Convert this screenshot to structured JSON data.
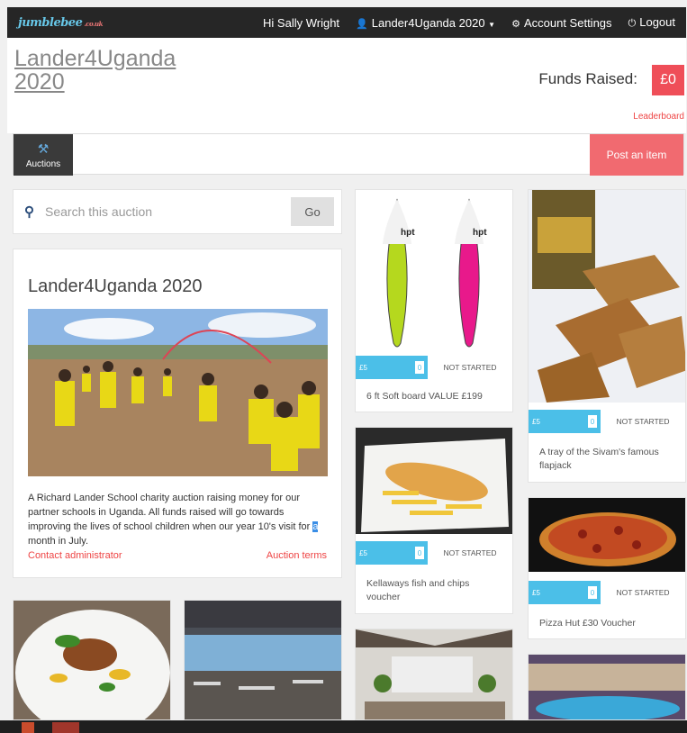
{
  "topbar": {
    "logo": "jumblebee",
    "logo_suffix": ".co.uk",
    "greeting": "Hi Sally Wright",
    "user_menu": "Lander4Uganda 2020",
    "account_settings": "Account Settings",
    "logout": "Logout"
  },
  "header": {
    "title": "Lander4Uganda 2020",
    "funds_label": "Funds Raised:",
    "funds_value": "£0",
    "leaderboard": "Leaderboard"
  },
  "tabs": {
    "auctions": "Auctions",
    "post_item": "Post an item"
  },
  "search": {
    "placeholder": "Search this auction",
    "go": "Go"
  },
  "auction_info": {
    "title": "Lander4Uganda 2020",
    "description_before": "A Richard Lander School charity auction raising money for our partner schools in Uganda. All funds raised will go towards improving the lives of school children when our year 10's visit for ",
    "description_highlight": "a",
    "description_after": " month in July.",
    "contact": "Contact administrator",
    "terms": "Auction terms"
  },
  "items": [
    {
      "title": "6 ft Soft board VALUE £199",
      "price": "£5",
      "bids": "0",
      "status": "NOT STARTED"
    },
    {
      "title": "Kellaways fish and chips voucher",
      "price": "£5",
      "bids": "0",
      "status": "NOT STARTED"
    },
    {
      "title": "A tray of the Sivam's famous flapjack",
      "price": "£5",
      "bids": "0",
      "status": "NOT STARTED"
    },
    {
      "title": "Pizza Hut £30 Voucher",
      "price": "£5",
      "bids": "0",
      "status": "NOT STARTED"
    }
  ],
  "board_brand": "hpt",
  "colors": {
    "accent_red": "#ef4e58",
    "bid_blue": "#4bbfe8",
    "topbar": "#262626"
  }
}
